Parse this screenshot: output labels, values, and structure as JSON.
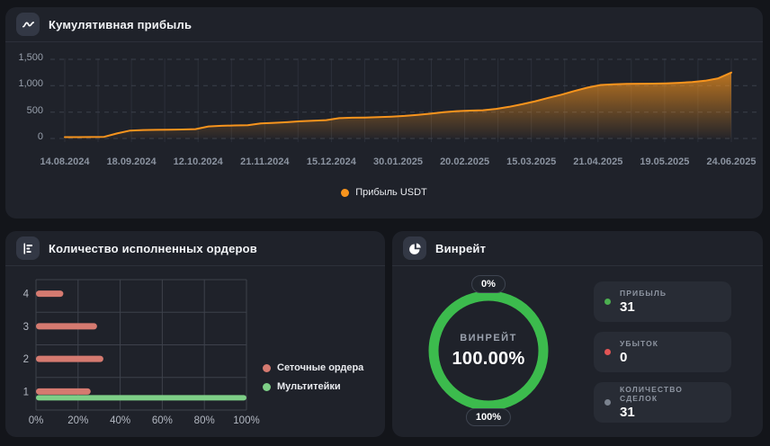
{
  "profit_panel": {
    "title": "Кумулятивная прибыль",
    "icon": "line-chart-icon",
    "chart_data": {
      "type": "area",
      "title": "Кумулятивная прибыль",
      "xlabel": "",
      "ylabel": "",
      "ylim": [
        0,
        1500
      ],
      "grid": true,
      "legend_position": "bottom",
      "yticks": [
        {
          "value": 1500,
          "label": "1,500"
        },
        {
          "value": 1000,
          "label": "1,000"
        },
        {
          "value": 500,
          "label": "500"
        },
        {
          "value": 0,
          "label": "0"
        }
      ],
      "xticks": [
        "14.08.2024",
        "18.09.2024",
        "12.10.2024",
        "21.11.2024",
        "15.12.2024",
        "30.01.2025",
        "20.02.2025",
        "15.03.2025",
        "21.04.2025",
        "19.05.2025",
        "24.06.2025"
      ],
      "series": [
        {
          "name": "Прибыль USDT",
          "color": "#f7941d",
          "values": [
            25,
            26,
            28,
            30,
            95,
            150,
            160,
            163,
            166,
            170,
            178,
            228,
            240,
            248,
            253,
            285,
            297,
            308,
            325,
            338,
            348,
            385,
            393,
            397,
            405,
            415,
            428,
            448,
            470,
            498,
            518,
            528,
            535,
            560,
            600,
            650,
            705,
            770,
            830,
            900,
            965,
            1015,
            1028,
            1035,
            1038,
            1040,
            1045,
            1055,
            1070,
            1095,
            1140,
            1250
          ]
        }
      ]
    }
  },
  "orders_panel": {
    "title": "Количество исполненных ордеров",
    "icon": "bar-list-icon",
    "chart_data": {
      "type": "bar",
      "orientation": "horizontal",
      "categories": [
        "4",
        "3",
        "2",
        "1"
      ],
      "xlim": [
        0,
        100
      ],
      "xticks": [
        "0%",
        "20%",
        "40%",
        "60%",
        "80%",
        "100%"
      ],
      "grid": true,
      "legend_position": "right",
      "series": [
        {
          "name": "Сеточные ордера",
          "color": "#d57a70",
          "values": [
            13,
            29,
            32,
            26
          ]
        },
        {
          "name": "Мультитейки",
          "color": "#7ecf87",
          "values": [
            0,
            0,
            0,
            100
          ]
        }
      ]
    }
  },
  "winrate_panel": {
    "title": "Винрейт",
    "icon": "pie-chart-icon",
    "chart_data": {
      "type": "pie",
      "label": "ВИНРЕЙТ",
      "value_label": "100.00%",
      "percent": 100,
      "color": "#3cbb4d",
      "top_badge": "0%",
      "bottom_badge": "100%"
    },
    "stats": [
      {
        "label": "ПРИБЫЛЬ",
        "value": "31",
        "dot_color": "#4caf50"
      },
      {
        "label": "УБЫТОК",
        "value": "0",
        "dot_color": "#e25555"
      },
      {
        "label": "КОЛИЧЕСТВО СДЕЛОК",
        "value": "31",
        "dot_color": "#7a828e"
      }
    ]
  }
}
